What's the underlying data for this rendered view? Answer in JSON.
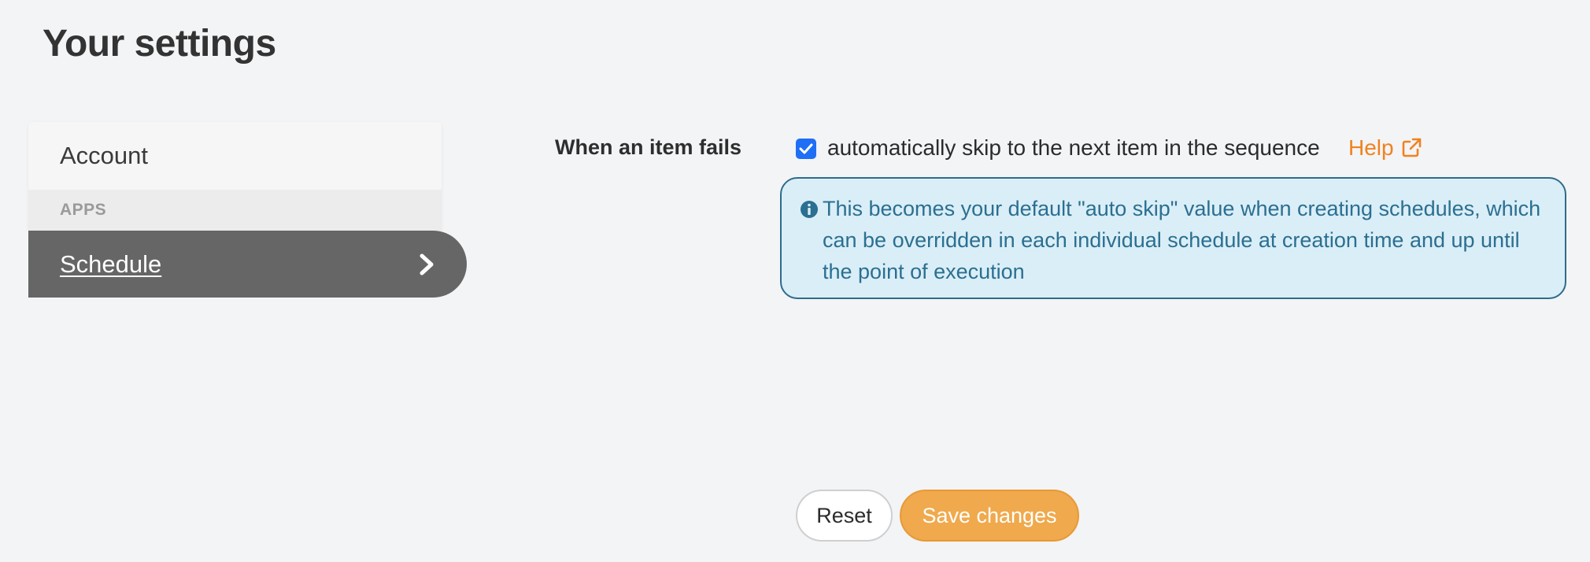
{
  "page": {
    "title": "Your settings"
  },
  "sidebar": {
    "items": [
      {
        "label": "Account",
        "active": false
      },
      {
        "label": "Schedule",
        "active": true
      }
    ],
    "section_label": "APPS",
    "active_chevron_icon": "chevron-right-icon"
  },
  "settings": {
    "item_fails": {
      "label": "When an item fails",
      "checkbox_checked": true,
      "checkbox_label": "automatically skip to the next item in the sequence",
      "help_label": "Help",
      "help_icon": "external-link-icon",
      "info_icon": "info-circle-icon",
      "info_text": "This becomes your default \"auto skip\" value when creating schedules, which can be overridden in each individual schedule at creation time and up until the point of execution"
    }
  },
  "actions": {
    "reset_label": "Reset",
    "save_label": "Save changes"
  },
  "colors": {
    "background": "#f3f4f6",
    "sidebar_active": "#666666",
    "help_link": "#f0821e",
    "info_bg": "#daeef7",
    "info_border": "#2f6b8a",
    "info_text": "#2b6f91",
    "checkbox": "#1e6ff5",
    "save_button": "#f0a94c"
  }
}
